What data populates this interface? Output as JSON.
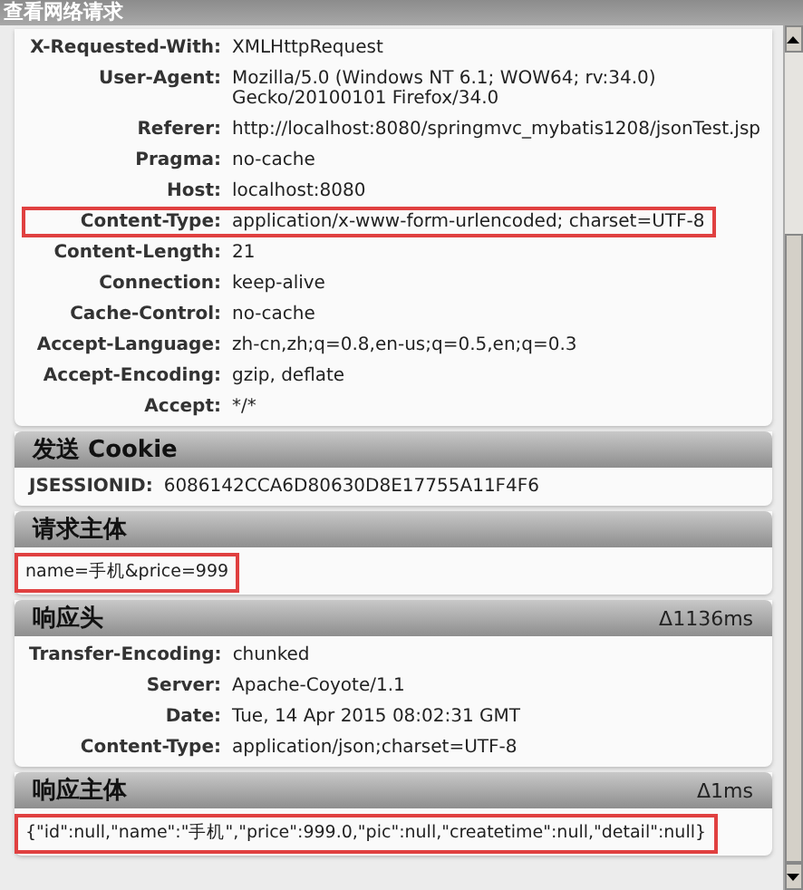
{
  "window": {
    "title": "查看网络请求"
  },
  "sections": [
    {
      "kind": "headers",
      "rows": [
        {
          "label": "X-Requested-With:",
          "value": "XMLHttpRequest",
          "highlighted": false
        },
        {
          "label": "User-Agent:",
          "value": "Mozilla/5.0 (Windows NT 6.1; WOW64; rv:34.0) Gecko/20100101 Firefox/34.0",
          "highlighted": false
        },
        {
          "label": "Referer:",
          "value": "http://localhost:8080/springmvc_mybatis1208/jsonTest.jsp",
          "highlighted": false
        },
        {
          "label": "Pragma:",
          "value": "no-cache",
          "highlighted": false
        },
        {
          "label": "Host:",
          "value": "localhost:8080",
          "highlighted": false
        },
        {
          "label": "Content-Type:",
          "value": "application/x-www-form-urlencoded; charset=UTF-8",
          "highlighted": true
        },
        {
          "label": "Content-Length:",
          "value": "21",
          "highlighted": false
        },
        {
          "label": "Connection:",
          "value": "keep-alive",
          "highlighted": false
        },
        {
          "label": "Cache-Control:",
          "value": "no-cache",
          "highlighted": false
        },
        {
          "label": "Accept-Language:",
          "value": "zh-cn,zh;q=0.8,en-us;q=0.5,en;q=0.3",
          "highlighted": false
        },
        {
          "label": "Accept-Encoding:",
          "value": "gzip, deflate",
          "highlighted": false
        },
        {
          "label": "Accept:",
          "value": "*/*",
          "highlighted": false
        }
      ]
    },
    {
      "kind": "cookies",
      "title": "发送 Cookie",
      "rows": [
        {
          "label": "JSESSIONID:",
          "value": "6086142CCA6D80630D8E17755A11F4F6",
          "highlighted": false
        }
      ]
    },
    {
      "kind": "body",
      "title": "请求主体",
      "highlighted": true,
      "body": "name=手机&price=999"
    },
    {
      "kind": "headers",
      "title": "响应头",
      "time": "Δ1136ms",
      "rows": [
        {
          "label": "Transfer-Encoding:",
          "value": "chunked",
          "highlighted": false
        },
        {
          "label": "Server:",
          "value": "Apache-Coyote/1.1",
          "highlighted": false
        },
        {
          "label": "Date:",
          "value": "Tue, 14 Apr 2015 08:02:31 GMT",
          "highlighted": false
        },
        {
          "label": "Content-Type:",
          "value": "application/json;charset=UTF-8",
          "highlighted": false
        }
      ]
    },
    {
      "kind": "body",
      "title": "响应主体",
      "time": "Δ1ms",
      "highlighted": true,
      "body": "{\"id\":null,\"name\":\"手机\",\"price\":999.0,\"pic\":null,\"createtime\":null,\"detail\":null}"
    }
  ]
}
